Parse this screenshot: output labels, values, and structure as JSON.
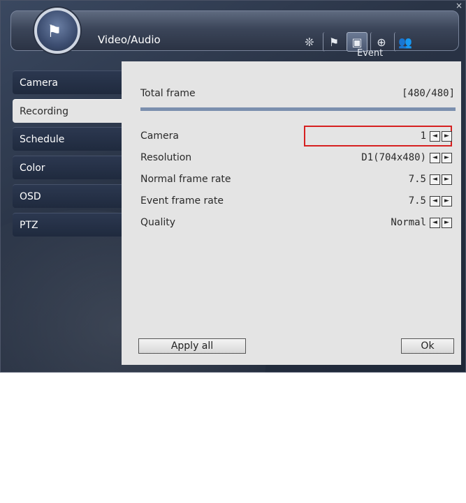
{
  "window": {
    "close_glyph": "×"
  },
  "header": {
    "title": "Video/Audio",
    "logo_icon": "camera-flag-icon",
    "nav": [
      {
        "icon": "system-icon",
        "glyph": "❊"
      },
      {
        "icon": "flag-camera-icon",
        "glyph": "⚑"
      },
      {
        "icon": "event-bell-icon",
        "glyph": "▣",
        "active": true
      },
      {
        "icon": "globe-icon",
        "glyph": "⊕"
      },
      {
        "icon": "users-icon",
        "glyph": "👥"
      }
    ],
    "active_nav_label": "Event"
  },
  "sidebar": {
    "items": [
      {
        "label": "Camera"
      },
      {
        "label": "Recording",
        "active": true
      },
      {
        "label": "Schedule"
      },
      {
        "label": "Color"
      },
      {
        "label": "OSD"
      },
      {
        "label": "PTZ"
      }
    ]
  },
  "main": {
    "total_frame_label": "Total frame",
    "total_frame_value": "[480/480]",
    "total_frame_fill": 1.0,
    "settings": [
      {
        "label": "Camera",
        "value": "1"
      },
      {
        "label": "Resolution",
        "value": "D1(704x480)"
      },
      {
        "label": "Normal frame rate",
        "value": "7.5"
      },
      {
        "label": "Event frame rate",
        "value": "7.5"
      },
      {
        "label": "Quality",
        "value": "Normal"
      }
    ],
    "arrow_left": "◄",
    "arrow_right": "►",
    "apply_all_label": "Apply all",
    "ok_label": "Ok"
  },
  "colors": {
    "highlight": "#d62020",
    "progress": "#7b8fae"
  }
}
